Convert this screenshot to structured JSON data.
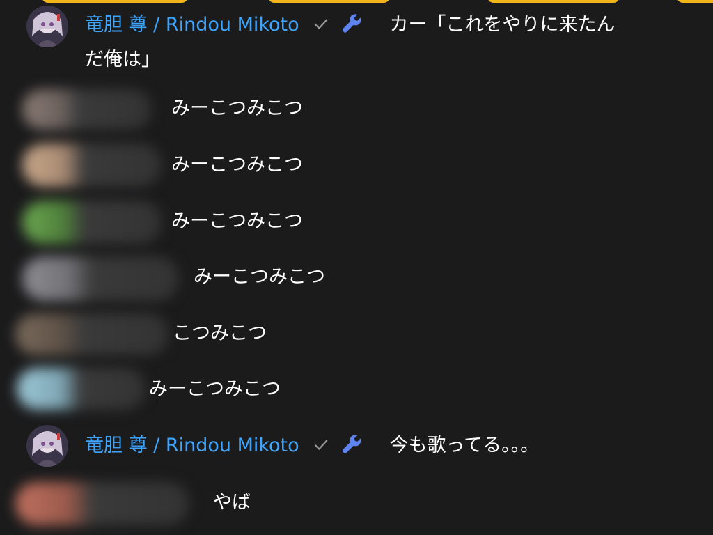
{
  "colors": {
    "background": "#1b1b1c",
    "author_blue": "#3ea6ff",
    "chip_yellow": "#f2b51c",
    "text": "#ffffff",
    "check_gray": "#9a9a9a"
  },
  "messages": [
    {
      "author": "竜胆 尊 / Rindou Mikoto",
      "badges": [
        "check-icon",
        "wrench-icon"
      ],
      "text_line1": "カー「これをやりに来たん",
      "text_line2": "だ俺は」"
    },
    {
      "author_hidden": true,
      "text": "みーこつみこつ",
      "avatar_color": "#8a7a72"
    },
    {
      "author_hidden": true,
      "text": "みーこつみこつ",
      "avatar_color": "#c9a88a"
    },
    {
      "author_hidden": true,
      "text": "みーこつみこつ",
      "avatar_color": "#6aa84f"
    },
    {
      "author_hidden": true,
      "text": "みーこつみこつ",
      "avatar_color": "#8d8d92"
    },
    {
      "author_hidden": true,
      "text": "こつみこつ",
      "avatar_color": "#7a6a5a"
    },
    {
      "author_hidden": true,
      "text": "みーこつみこつ",
      "avatar_color": "#9cc8d8"
    },
    {
      "author": "竜胆 尊 / Rindou Mikoto",
      "badges": [
        "check-icon",
        "wrench-icon"
      ],
      "text": "今も歌ってる。。。"
    },
    {
      "author_hidden": true,
      "text": "やば",
      "avatar_color": "#c0705e"
    }
  ]
}
